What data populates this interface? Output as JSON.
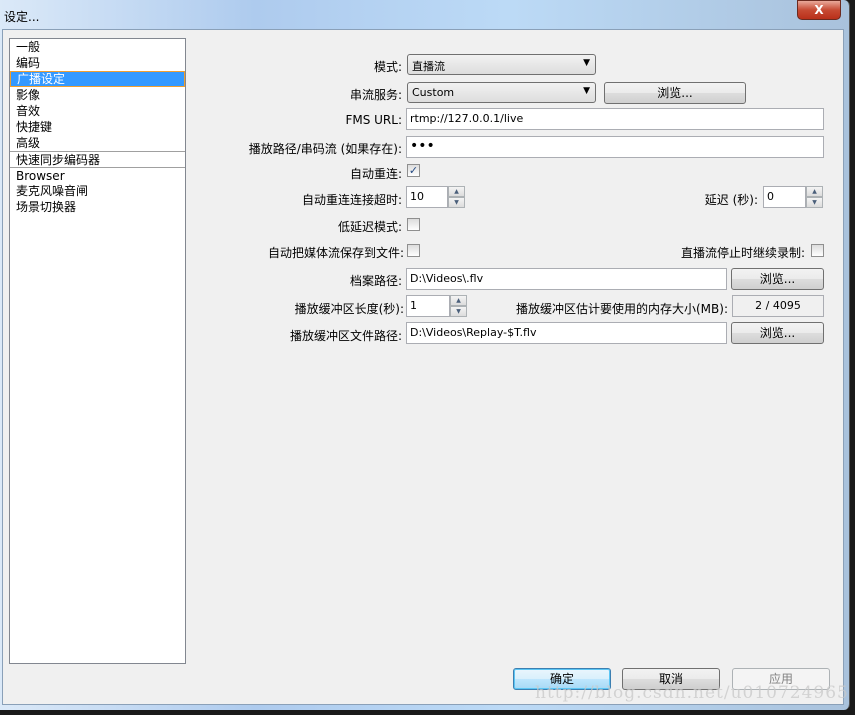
{
  "window": {
    "title": "设定...",
    "close_label": "X"
  },
  "sidebar": {
    "items": [
      {
        "label": "一般"
      },
      {
        "label": "编码"
      },
      {
        "label": "广播设定",
        "selected": true
      },
      {
        "label": "影像"
      },
      {
        "label": "音效"
      },
      {
        "label": "快捷键"
      },
      {
        "label": "高级"
      },
      {
        "label": "快速同步编码器"
      },
      {
        "label": "Browser"
      },
      {
        "label": "麦克风噪音闸"
      },
      {
        "label": "场景切换器"
      }
    ]
  },
  "form": {
    "mode_label": "模式:",
    "mode_value": "直播流",
    "service_label": "串流服务:",
    "service_value": "Custom",
    "browse_label": "浏览...",
    "fms_label": "FMS URL:",
    "fms_value": "rtmp://127.0.0.1/live",
    "key_label": "播放路径/串码流 (如果存在):",
    "key_value": "•••",
    "reconnect_label": "自动重连:",
    "reconnect_checked": true,
    "reconnect_timeout_label": "自动重连连接超时:",
    "reconnect_timeout_value": "10",
    "delay_label": "延迟 (秒):",
    "delay_value": "0",
    "low_latency_label": "低延迟模式:",
    "low_latency_checked": false,
    "save_to_file_label": "自动把媒体流保存到文件:",
    "save_to_file_checked": false,
    "keep_recording_label": "直播流停止时继续录制:",
    "keep_recording_checked": false,
    "file_path_label": "档案路径:",
    "file_path_value": "D:\\Videos\\.flv",
    "replay_len_label": "播放缓冲区长度(秒):",
    "replay_len_value": "1",
    "replay_mem_label": "播放缓冲区估计要使用的内存大小(MB):",
    "replay_mem_value": "2 / 4095",
    "replay_path_label": "播放缓冲区文件路径:",
    "replay_path_value": "D:\\Videos\\Replay-$T.flv"
  },
  "footer": {
    "ok": "确定",
    "cancel": "取消",
    "apply": "应用"
  },
  "watermark": "http://blog.csdn.net/u010724965"
}
